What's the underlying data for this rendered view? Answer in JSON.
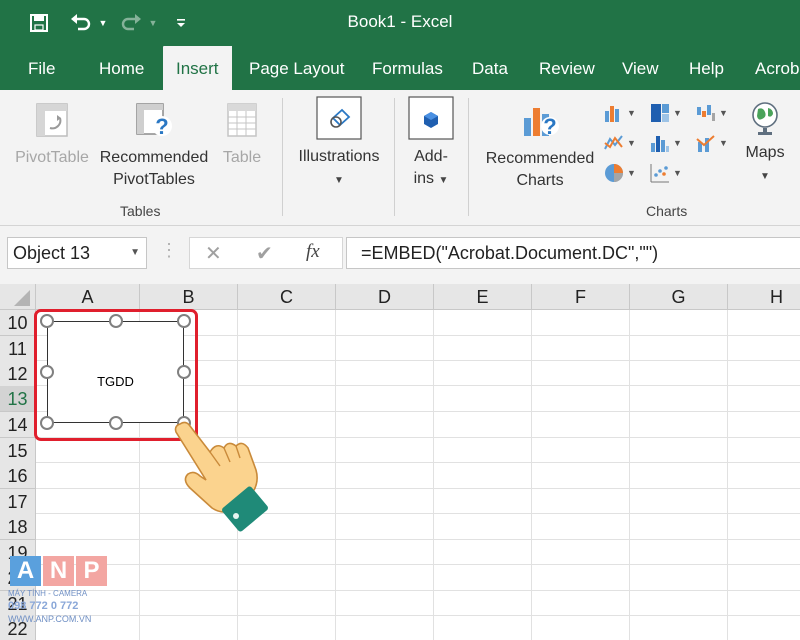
{
  "window": {
    "title": "Book1  -  Excel"
  },
  "quick_access": {
    "save_icon": "save-icon",
    "undo_icon": "undo-icon",
    "redo_icon": "redo-icon",
    "customize_icon": "customize-qat-icon"
  },
  "tabs": [
    "File",
    "Home",
    "Insert",
    "Page Layout",
    "Formulas",
    "Data",
    "Review",
    "View",
    "Help",
    "Acrob"
  ],
  "active_tab": "Insert",
  "ribbon": {
    "tables_group": {
      "label": "Tables",
      "pivottable": "PivotTable",
      "recommended_line1": "Recommended",
      "recommended_line2": "PivotTables",
      "table": "Table"
    },
    "illustrations": {
      "label": "Illustrations"
    },
    "addins": {
      "line1": "Add-",
      "line2": "ins"
    },
    "charts_group": {
      "label": "Charts",
      "recommended_line1": "Recommended",
      "recommended_line2": "Charts",
      "maps": "Maps"
    }
  },
  "formula_bar": {
    "name_box": "Object 13",
    "cancel_symbol": "✕",
    "enter_symbol": "✔",
    "fx_symbol": "fx",
    "formula": "=EMBED(\"Acrobat.Document.DC\",\"\")"
  },
  "columns": [
    "A",
    "B",
    "C",
    "D",
    "E",
    "F",
    "G",
    "H"
  ],
  "rows": [
    "10",
    "11",
    "12",
    "13",
    "14",
    "15",
    "16",
    "17",
    "18",
    "19",
    "20",
    "21",
    "22"
  ],
  "selected_row": "13",
  "embedded_object": {
    "label": "TGDD"
  },
  "watermark": {
    "letters": [
      "A",
      "N",
      "P"
    ],
    "line1": "MÁY TÍNH - CAMERA",
    "line2": "098 772 0 772",
    "line3": "WWW.ANP.COM.VN"
  },
  "colors": {
    "excel_green": "#217346",
    "highlight_red": "#e01f2d",
    "ribbon_bg": "#f3f3f3"
  }
}
